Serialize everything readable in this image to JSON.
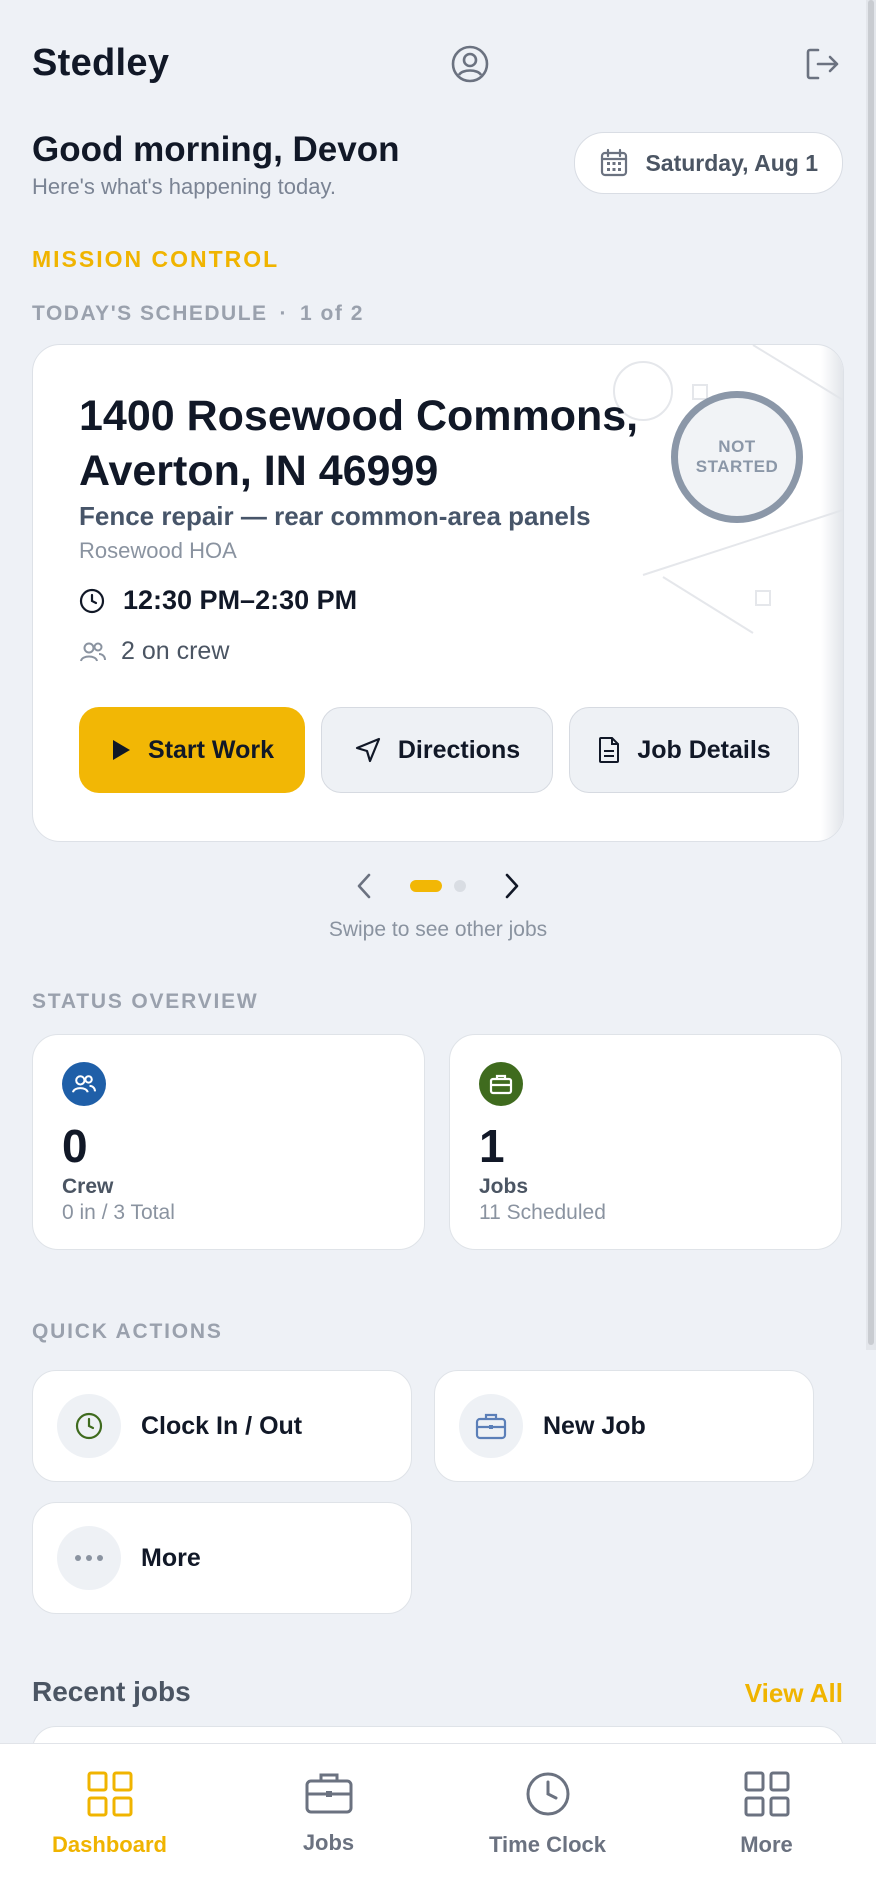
{
  "header": {
    "app_name": "Stedley"
  },
  "greeting": {
    "title": "Good morning, Devon",
    "subtitle": "Here's what's happening today."
  },
  "date_pill": {
    "label": "Saturday, Aug 1"
  },
  "mission": {
    "label": "MISSION CONTROL"
  },
  "schedule": {
    "label": "TODAY'S SCHEDULE",
    "separator": "·",
    "position": "1 of 2",
    "swipe_hint": "Swipe to see other jobs",
    "job": {
      "address": "1400 Rosewood Commons, Averton, IN 46999",
      "description": "Fence repair — rear common-area panels",
      "client": "Rosewood HOA",
      "time": "12:30 PM–2:30 PM",
      "crew": "2 on crew",
      "status": "NOT STARTED",
      "buttons": {
        "start": "Start Work",
        "directions": "Directions",
        "details": "Job Details"
      }
    }
  },
  "status_overview": {
    "label": "STATUS OVERVIEW",
    "cards": [
      {
        "icon": "crew-icon",
        "value": "0",
        "label": "Crew",
        "sub": "0 in / 3 Total",
        "color": "#1f5fa8"
      },
      {
        "icon": "briefcase-icon",
        "value": "1",
        "label": "Jobs",
        "sub": "11 Scheduled",
        "color": "#3f6b1e"
      }
    ]
  },
  "quick_actions": {
    "label": "QUICK ACTIONS",
    "items": [
      {
        "icon": "clock-icon",
        "label": "Clock In / Out"
      },
      {
        "icon": "briefcase-icon",
        "label": "New Job"
      },
      {
        "icon": "more-dots-icon",
        "label": "More"
      }
    ]
  },
  "recent": {
    "title": "Recent jobs",
    "view_all": "View All"
  },
  "bottom_nav": {
    "items": [
      {
        "icon": "dashboard-icon",
        "label": "Dashboard",
        "active": true
      },
      {
        "icon": "briefcase-icon",
        "label": "Jobs",
        "active": false
      },
      {
        "icon": "clock-icon",
        "label": "Time Clock",
        "active": false
      },
      {
        "icon": "grid-icon",
        "label": "More",
        "active": false
      }
    ]
  },
  "colors": {
    "accent": "#f2b705",
    "background": "#eef1f6",
    "text": "#111827",
    "muted": "#8a93a0"
  }
}
